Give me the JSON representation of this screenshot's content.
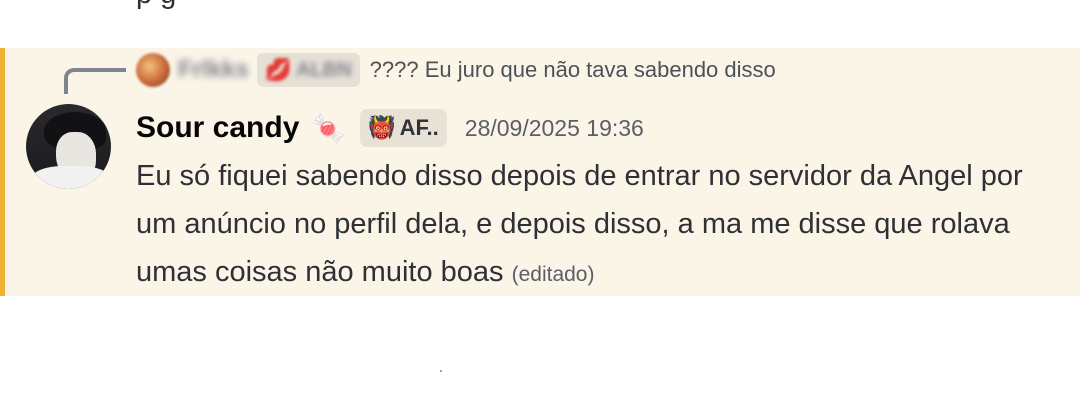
{
  "previous_message": {
    "tail_text": "p   g"
  },
  "message": {
    "reply": {
      "author_name": "Frlkks",
      "role_tag": "ALBN",
      "text": "???? Eu juro que não tava sabendo disso"
    },
    "author": {
      "name": "Sour candy",
      "badge_icon": "candy-icon",
      "role_tag": "AF..",
      "role_icon": "demon-icon"
    },
    "timestamp": "28/09/2025 19:36",
    "content": "Eu só fiquei sabendo disso depois de entrar no servidor da Angel por um anúncio no perfil dela, e depois disso, a ma me disse que rolava umas coisas não muito boas",
    "edited_label": "(editado)",
    "highlight_color": "#f0b232"
  }
}
